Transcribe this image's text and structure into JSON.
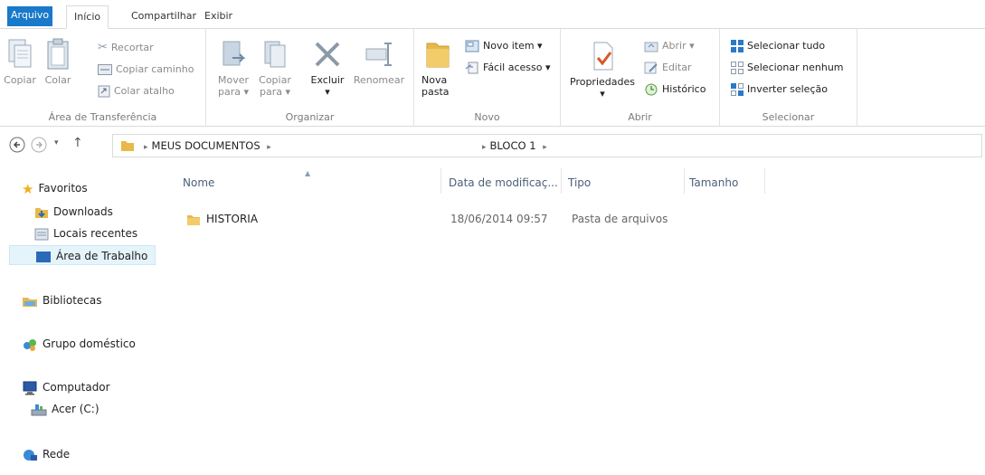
{
  "menu_tabs": {
    "file": "Arquivo",
    "home": "Início",
    "share": "Compartilhar",
    "view": "Exibir"
  },
  "ribbon": {
    "clipboard": {
      "label": "Área de Transferência",
      "copy": "Copiar",
      "paste": "Colar",
      "cut": "Recortar",
      "copy_path": "Copiar caminho",
      "paste_shortcut": "Colar atalho"
    },
    "organize": {
      "label": "Organizar",
      "move_to_1": "Mover",
      "move_to_2": "para",
      "copy_to_1": "Copiar",
      "copy_to_2": "para",
      "delete": "Excluir",
      "rename": "Renomear"
    },
    "new": {
      "label": "Novo",
      "new_folder_1": "Nova",
      "new_folder_2": "pasta",
      "new_item": "Novo item",
      "easy_access": "Fácil acesso"
    },
    "open": {
      "label": "Abrir",
      "properties": "Propriedades",
      "open": "Abrir",
      "edit": "Editar",
      "history": "Histórico"
    },
    "select": {
      "label": "Selecionar",
      "select_all": "Selecionar tudo",
      "select_none": "Selecionar nenhum",
      "invert": "Inverter seleção"
    }
  },
  "address": {
    "crumbs": [
      "MEUS DOCUMENTOS",
      "BLOCO 1"
    ]
  },
  "nav_pane": {
    "favorites": "Favoritos",
    "downloads": "Downloads",
    "recent": "Locais recentes",
    "desktop": "Área de Trabalho",
    "libraries": "Bibliotecas",
    "homegroup": "Grupo doméstico",
    "computer": "Computador",
    "drive": "Acer (C:)",
    "network": "Rede"
  },
  "columns": {
    "name": "Nome",
    "date": "Data de modificaç...",
    "type": "Tipo",
    "size": "Tamanho"
  },
  "files": [
    {
      "name": "HISTORIA",
      "date": "18/06/2014 09:57",
      "type": "Pasta de arquivos",
      "size": ""
    }
  ],
  "colors": {
    "file_tab": "#1979ca",
    "folder": "#e8b84a",
    "selection": "#e5f3fb",
    "header_text": "#4c607a"
  }
}
